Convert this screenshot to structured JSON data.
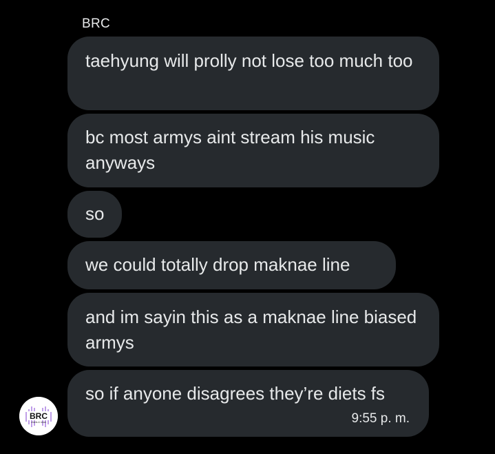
{
  "conversation": {
    "sender_name": "BRC",
    "messages": [
      {
        "text": "taehyung will prolly not lose too much too"
      },
      {
        "text": "bc most armys aint stream his music anyways"
      },
      {
        "text": "so"
      },
      {
        "text": "we could totally drop maknae line"
      },
      {
        "text": "and im sayin this as a maknae line biased armys"
      },
      {
        "text": "so if anyone disagrees they’re diets fs",
        "timestamp": "9:55 p. m."
      }
    ]
  },
  "avatar": {
    "logo_text": "BRC",
    "logo_subtext": "charts & news"
  },
  "colors": {
    "background": "#000000",
    "bubble": "#262a2e",
    "text": "#e7e9ea",
    "avatar_bg": "#ffffff",
    "avatar_accent": "#8a4fd6"
  }
}
